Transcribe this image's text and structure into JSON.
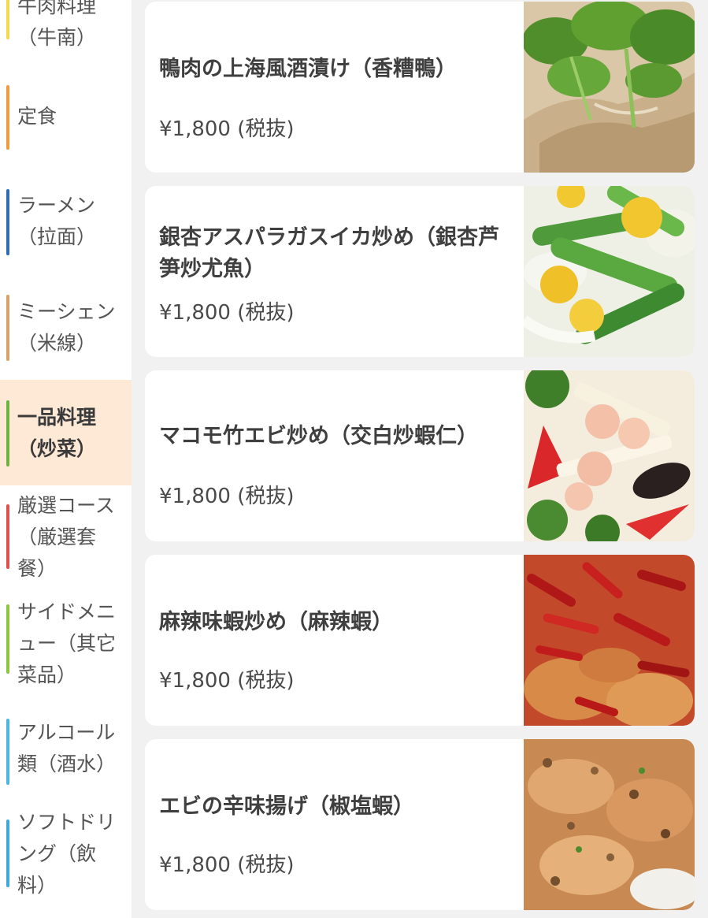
{
  "sidebar": {
    "items": [
      {
        "label": "牛肉料理（牛南）",
        "color": "#f2d94e"
      },
      {
        "label": "定食",
        "color": "#f19a3e"
      },
      {
        "label": "ラーメン（拉面）",
        "color": "#2f6db5"
      },
      {
        "label": "ミーシェン（米線）",
        "color": "#d6a46a"
      },
      {
        "label": "一品料理（炒菜）",
        "color": "#6cb33f",
        "active": true
      },
      {
        "label": "厳選コース（厳選套餐）",
        "color": "#e2504c"
      },
      {
        "label": "サイドメニュー（其它菜品）",
        "color": "#8cc63f"
      },
      {
        "label": "アルコール類（酒水）",
        "color": "#4ab8e0"
      },
      {
        "label": "ソフトドリング（飲料）",
        "color": "#3fa9d8"
      }
    ]
  },
  "menu": {
    "items": [
      {
        "name": "鴨肉の上海風酒漬け（香糟鴨）",
        "price": "¥1,800 (税抜)",
        "photo": "duck-photo"
      },
      {
        "name": "銀杏アスパラガスイカ炒め（銀杏芦笋炒尤魚）",
        "price": "¥1,800 (税抜)",
        "photo": "asparagus-squid-photo"
      },
      {
        "name": "マコモ竹エビ炒め（交白炒蝦仁）",
        "price": "¥1,800 (税抜)",
        "photo": "shrimp-stirfry-photo"
      },
      {
        "name": "麻辣味蝦炒め（麻辣蝦）",
        "price": "¥1,800 (税抜)",
        "photo": "spicy-shrimp-photo"
      },
      {
        "name": "エビの辛味揚げ（椒塩蝦）",
        "price": "¥1,800 (税抜)",
        "photo": "fried-shrimp-photo"
      }
    ]
  }
}
